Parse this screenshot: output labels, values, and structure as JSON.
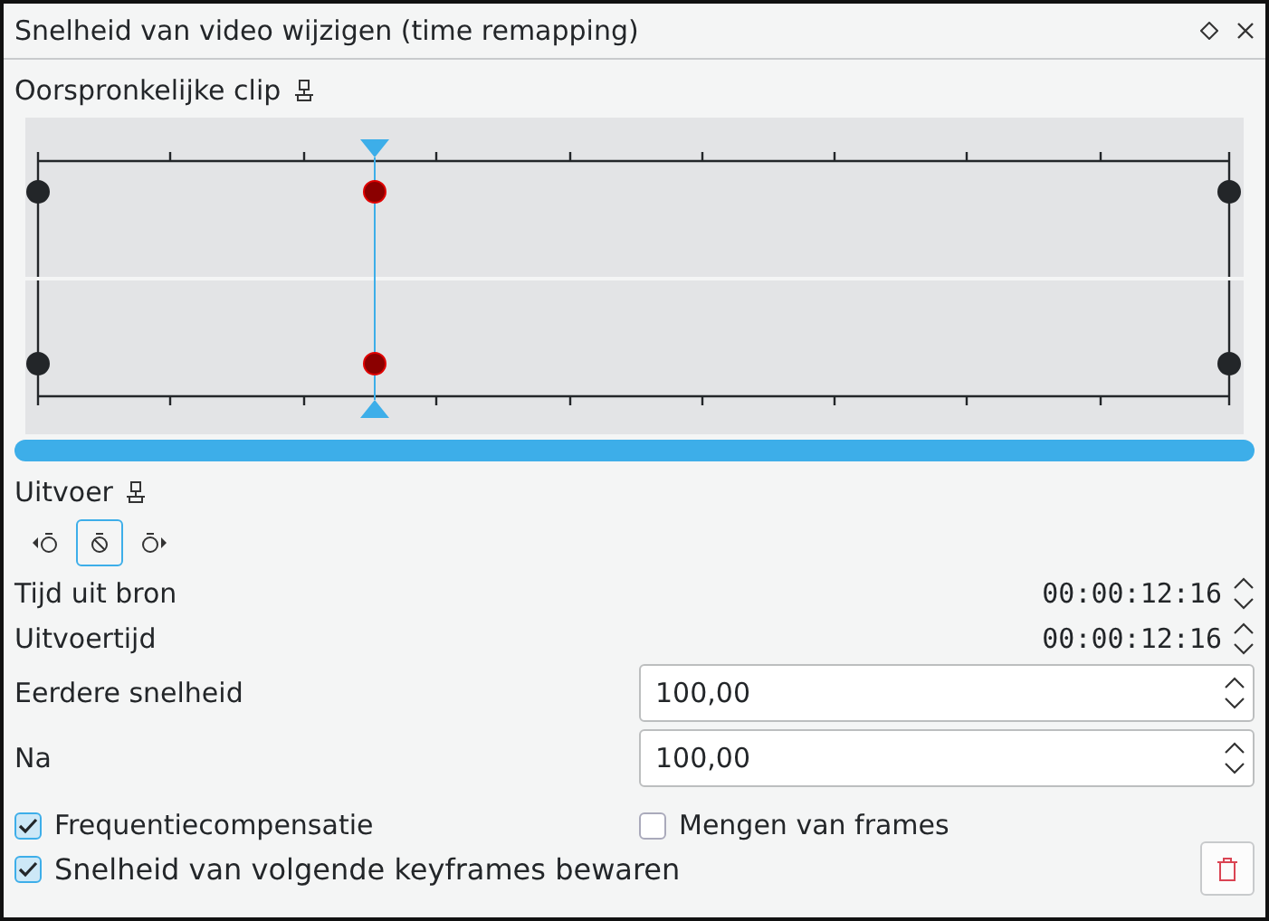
{
  "window": {
    "title": "Snelheid van video wijzigen (time remapping)"
  },
  "source": {
    "label": "Oorspronkelijke clip"
  },
  "keyframes": [
    {
      "selected": false
    },
    {
      "selected": true
    },
    {
      "selected": false
    }
  ],
  "output": {
    "label": "Uitvoer"
  },
  "keyframe_buttons": [
    {
      "kind": "previous",
      "selected": false
    },
    {
      "kind": "toggle",
      "selected": true
    },
    {
      "kind": "next",
      "selected": false
    }
  ],
  "times": [
    {
      "label": "Tijd uit bron",
      "value": "00:00:12:16"
    },
    {
      "label": "Uitvoertijd",
      "value": "00:00:12:16"
    }
  ],
  "speeds": [
    {
      "label": "Eerdere snelheid",
      "value": "100,00"
    },
    {
      "label": "Na",
      "value": "100,00"
    }
  ],
  "options": [
    {
      "label": "Frequentiecompensatie",
      "checked": true
    },
    {
      "label": "Mengen van frames",
      "checked": false
    },
    {
      "label": "Snelheid van volgende keyframes bewaren",
      "checked": true
    }
  ]
}
